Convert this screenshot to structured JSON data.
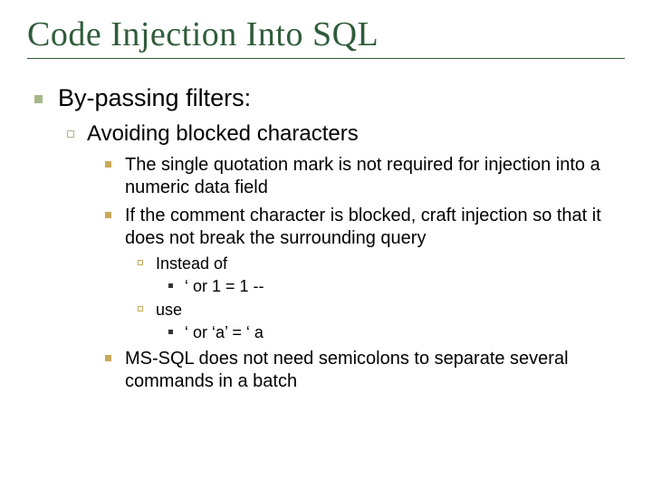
{
  "title": "Code Injection Into SQL",
  "l1": "By-passing filters:",
  "l2": "Avoiding blocked characters",
  "l3a": "The single quotation mark is not required for injection into a numeric data field",
  "l3b": "If the comment character is blocked, craft injection so that it does not break the surrounding query",
  "l4a": "Instead of",
  "l5a": "‘ or 1 = 1 --",
  "l4b": "use",
  "l5b": "‘ or ‘a’ = ‘ a",
  "l3c": "MS-SQL does not need semicolons to separate several commands in a batch"
}
